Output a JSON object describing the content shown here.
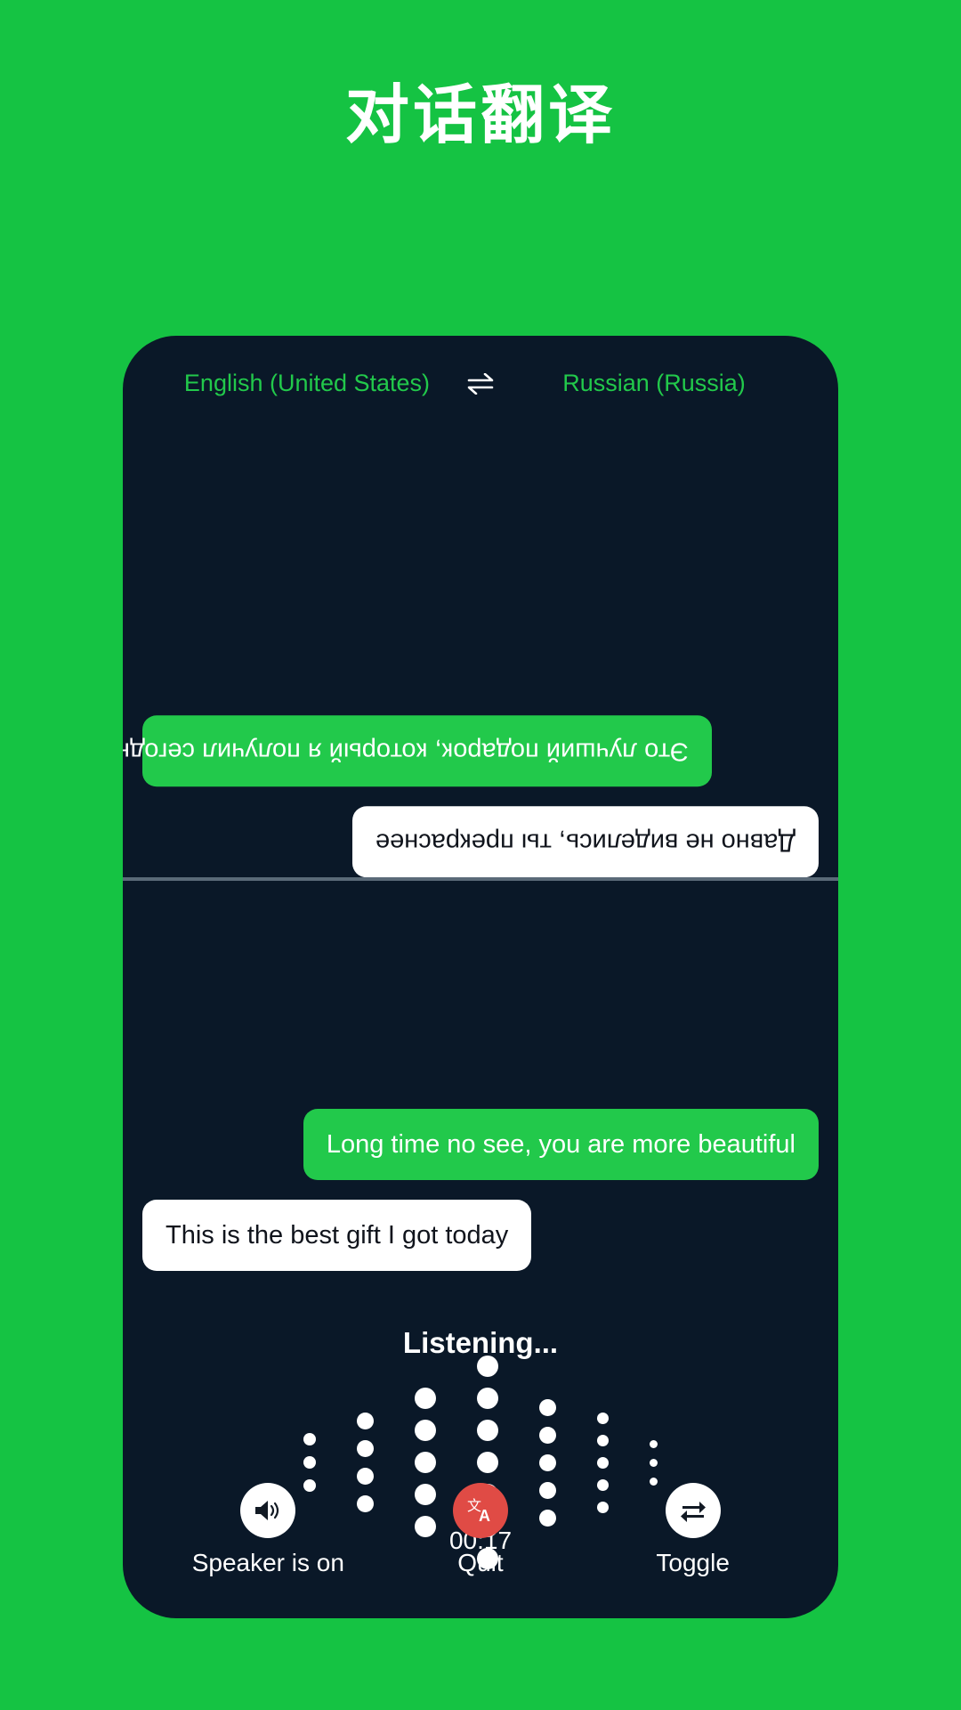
{
  "page": {
    "title": "对话翻译",
    "background_color": "#15c343",
    "card_color": "#0a1828",
    "accent_green": "#22c94b",
    "quit_red": "#e04b45"
  },
  "language_bar": {
    "source_language": "English (United States)",
    "target_language": "Russian (Russia)",
    "swap_icon": "swap-horizontal-icon"
  },
  "conversation": {
    "translated_pane": {
      "orientation": "rotated-180",
      "messages": [
        {
          "text": "Это лучший подарок, который я получил сегодня",
          "style": "green",
          "align": "left"
        },
        {
          "text": "Давно не виделись, ты прекраснее",
          "style": "white",
          "align": "right"
        }
      ]
    },
    "source_pane": {
      "orientation": "normal",
      "messages": [
        {
          "text": "Long time no see, you are more beautiful",
          "style": "green",
          "align": "right"
        },
        {
          "text": "This is the best gift I got today",
          "style": "white",
          "align": "left"
        }
      ]
    }
  },
  "status": {
    "listening_label": "Listening...",
    "timer": "00:17"
  },
  "waveform": {
    "columns": [
      {
        "dots": 3,
        "size": 14
      },
      {
        "dots": 4,
        "size": 19
      },
      {
        "dots": 5,
        "size": 24
      },
      {
        "dots": 7,
        "size": 24
      },
      {
        "dots": 5,
        "size": 19
      },
      {
        "dots": 5,
        "size": 13
      },
      {
        "dots": 3,
        "size": 9
      }
    ],
    "gap": 12,
    "color": "#ffffff"
  },
  "controls": [
    {
      "label": "Speaker is on",
      "icon": "speaker-on-icon",
      "circle": "white"
    },
    {
      "label": "Quit",
      "icon": "translate-icon",
      "circle": "red"
    },
    {
      "label": "Toggle",
      "icon": "toggle-swap-icon",
      "circle": "white"
    }
  ]
}
